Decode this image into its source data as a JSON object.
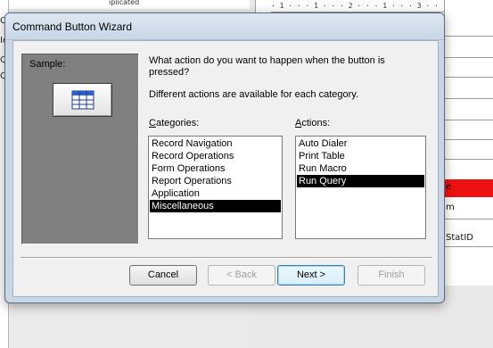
{
  "background": {
    "left_fragments": [
      "Ci",
      "Ic",
      "Qu",
      "Qu"
    ],
    "top_fragment": "iplicated",
    "ruler": "· 1 · · · 1 · · · 2 · · · 1 · · · 3 · · · 1 · · · 4",
    "field_labels": [
      "e",
      "m",
      "StatID"
    ]
  },
  "dialog": {
    "title": "Command Button Wizard",
    "sample_label": "Sample:",
    "sample_icon": "table-grid-icon",
    "question": "What action do you want to happen when the button is pressed?",
    "hint": "Different actions are available for each category.",
    "categories_label_accel": "C",
    "categories_label_rest": "ategories:",
    "actions_label_accel": "A",
    "actions_label_rest": "ctions:",
    "categories": [
      "Record Navigation",
      "Record Operations",
      "Form Operations",
      "Report Operations",
      "Application",
      "Miscellaneous"
    ],
    "selected_category": "Miscellaneous",
    "actions": [
      "Auto Dialer",
      "Print Table",
      "Run Macro",
      "Run Query"
    ],
    "selected_action": "Run Query",
    "buttons": {
      "cancel": "Cancel",
      "back": "< Back",
      "next": "Next >",
      "finish": "Finish"
    }
  },
  "colors": {
    "selection_bg": "#000000",
    "highlight_field": "#ee1111",
    "sample_panel": "#808080"
  }
}
